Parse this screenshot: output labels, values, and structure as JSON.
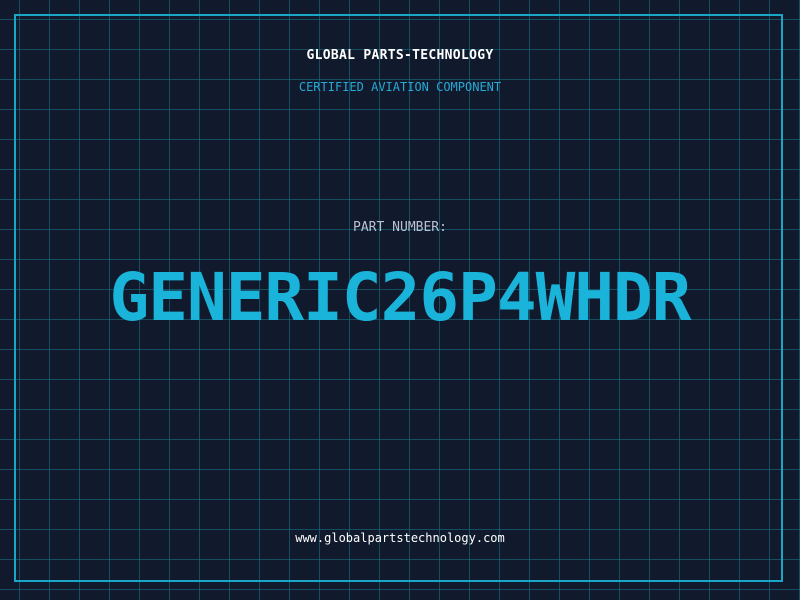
{
  "header": {
    "company_name": "GLOBAL PARTS-TECHNOLOGY",
    "tagline": "CERTIFIED AVIATION COMPONENT"
  },
  "part": {
    "label": "PART NUMBER:",
    "number": "GENERIC26P4WHDR"
  },
  "footer": {
    "website": "www.globalpartstechnology.com"
  },
  "colors": {
    "background": "#111a2c",
    "grid": "#18788c",
    "frame": "#1aa6c6",
    "accent": "#1ab3da"
  }
}
